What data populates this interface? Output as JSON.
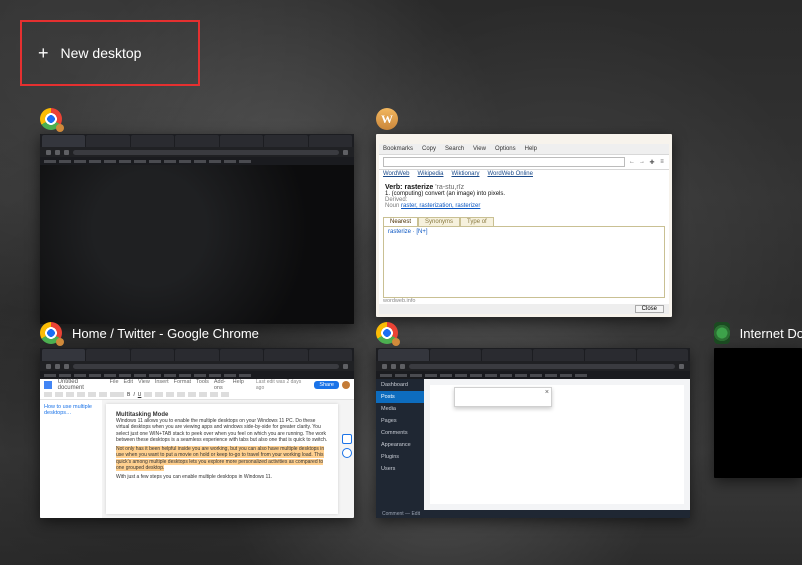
{
  "new_desktop": {
    "label": "New desktop"
  },
  "tiles": {
    "chrome_dark": {
      "title": ""
    },
    "wordweb": {
      "menu": [
        "Bookmarks",
        "Copy",
        "Search",
        "View",
        "Options",
        "Help"
      ],
      "sources": [
        "WordWeb",
        "Wikipedia",
        "Wiktionary",
        "WordWeb Online"
      ],
      "nav_back": "←",
      "nav_fwd": "→",
      "nav_tools1": "✚",
      "nav_tools2": "≡",
      "headword_label": "Verb:",
      "headword": "rasterize",
      "pron": "'ra-stu,rīz",
      "definition": "1. (computing) convert (an image) into pixels.",
      "derived_label": "Derived:",
      "derived_noun": "Noun",
      "derived_links": "raster, rasterization, rasterizer",
      "tabs": [
        "Nearest",
        "Synonyms",
        "Type of"
      ],
      "panel_line": "rasterize · [N+]",
      "footer_link": "wordweb.info",
      "close_btn": "Close"
    },
    "docs": {
      "title": "Home / Twitter - Google Chrome",
      "doc_title": "Untitled document",
      "menus": [
        "File",
        "Edit",
        "View",
        "Insert",
        "Format",
        "Tools",
        "Add-ons",
        "Help"
      ],
      "saved": "Last edit was 2 days ago",
      "share": "Share",
      "outline_heading": "How to use multiple desktops…",
      "page_h": "Multitasking Mode",
      "para1": "Windows 11 allows you to enable the multiple desktops on your Windows 11 PC. Do these virtual desktops when you are viewing apps and windows side-by-side for greater clarity. You select just one WIN+TAB stack to peek over when you feel on which you are running. The work between these desktops is a seamless experience with tabs but also one that is quick to switch.",
      "para2": "Not only has it been helpful inside you are working, but you can also have multiple desktops in use when you want to put a movie on hold or keep to-go to travel from your working load. This quick's among multiple desktops lets you explore more personalized activities as compared to one grouped desktop.",
      "para3": "With just a few steps you can enable multiple desktops in Windows 11."
    },
    "wp": {
      "title": "",
      "side": [
        "Dashboard",
        "Posts",
        "Media",
        "Pages",
        "Comments",
        "Appearance",
        "Plugins",
        "Users"
      ],
      "status_left": "Comment — Edit",
      "popup_label": ""
    },
    "idm": {
      "title": "Internet Do"
    }
  }
}
